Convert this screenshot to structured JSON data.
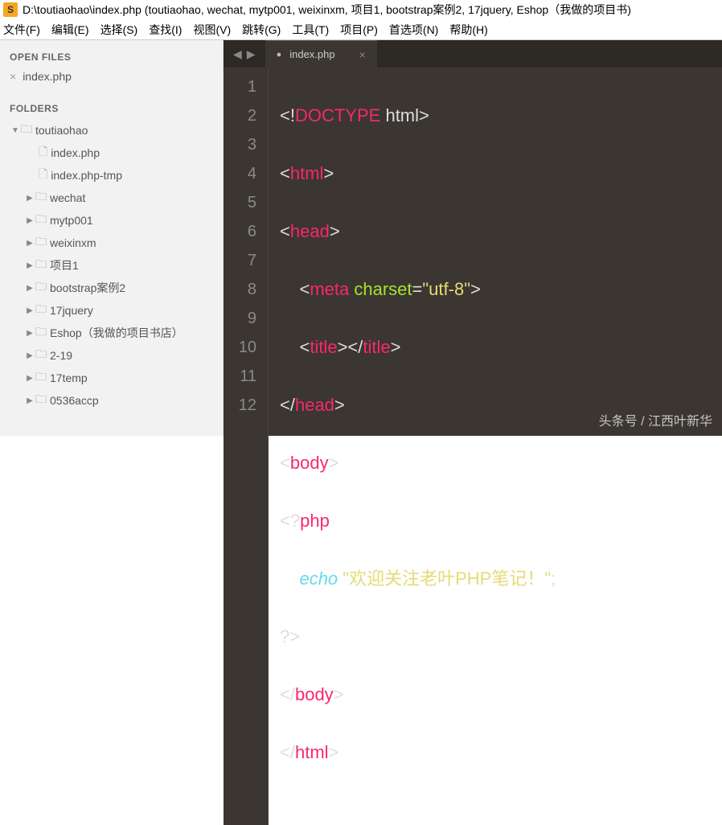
{
  "titlebar": {
    "path": "D:\\toutiaohao\\index.php (toutiaohao, wechat, mytp001, weixinxm, 项目1, bootstrap案例2, 17jquery, Eshop（我做的项目书)"
  },
  "menu": {
    "file": "文件(F)",
    "edit": "编辑(E)",
    "select": "选择(S)",
    "find": "查找(I)",
    "view": "视图(V)",
    "goto": "跳转(G)",
    "tools": "工具(T)",
    "project": "项目(P)",
    "prefs": "首选项(N)",
    "help": "帮助(H)"
  },
  "sidebar": {
    "open_files_label": "OPEN FILES",
    "open_file": "index.php",
    "folders_label": "FOLDERS",
    "root": "toutiaohao",
    "files": {
      "f1": "index.php",
      "f2": "index.php-tmp"
    },
    "folders": {
      "d1": "wechat",
      "d2": "mytp001",
      "d3": "weixinxm",
      "d4": "项目1",
      "d5": "bootstrap案例2",
      "d6": "17jquery",
      "d7": "Eshop（我做的项目书店）",
      "d8": "2-19",
      "d9": "17temp",
      "d10": "0536accp"
    }
  },
  "tab": {
    "name": "index.php"
  },
  "code": {
    "lines": [
      "1",
      "2",
      "3",
      "4",
      "5",
      "6",
      "7",
      "8",
      "9",
      "10",
      "11",
      "12"
    ],
    "doctype_word": "DOCTYPE",
    "html_word": "html",
    "head": "head",
    "meta": "meta",
    "charset_attr": "charset",
    "charset_val": "\"utf-8\"",
    "title": "title",
    "body": "body",
    "php_open": "php",
    "echo": "echo",
    "string": "\"欢迎关注老叶PHP笔记！\"",
    "php_close": "?>"
  },
  "watermark": "头条号 / 江西叶新华"
}
